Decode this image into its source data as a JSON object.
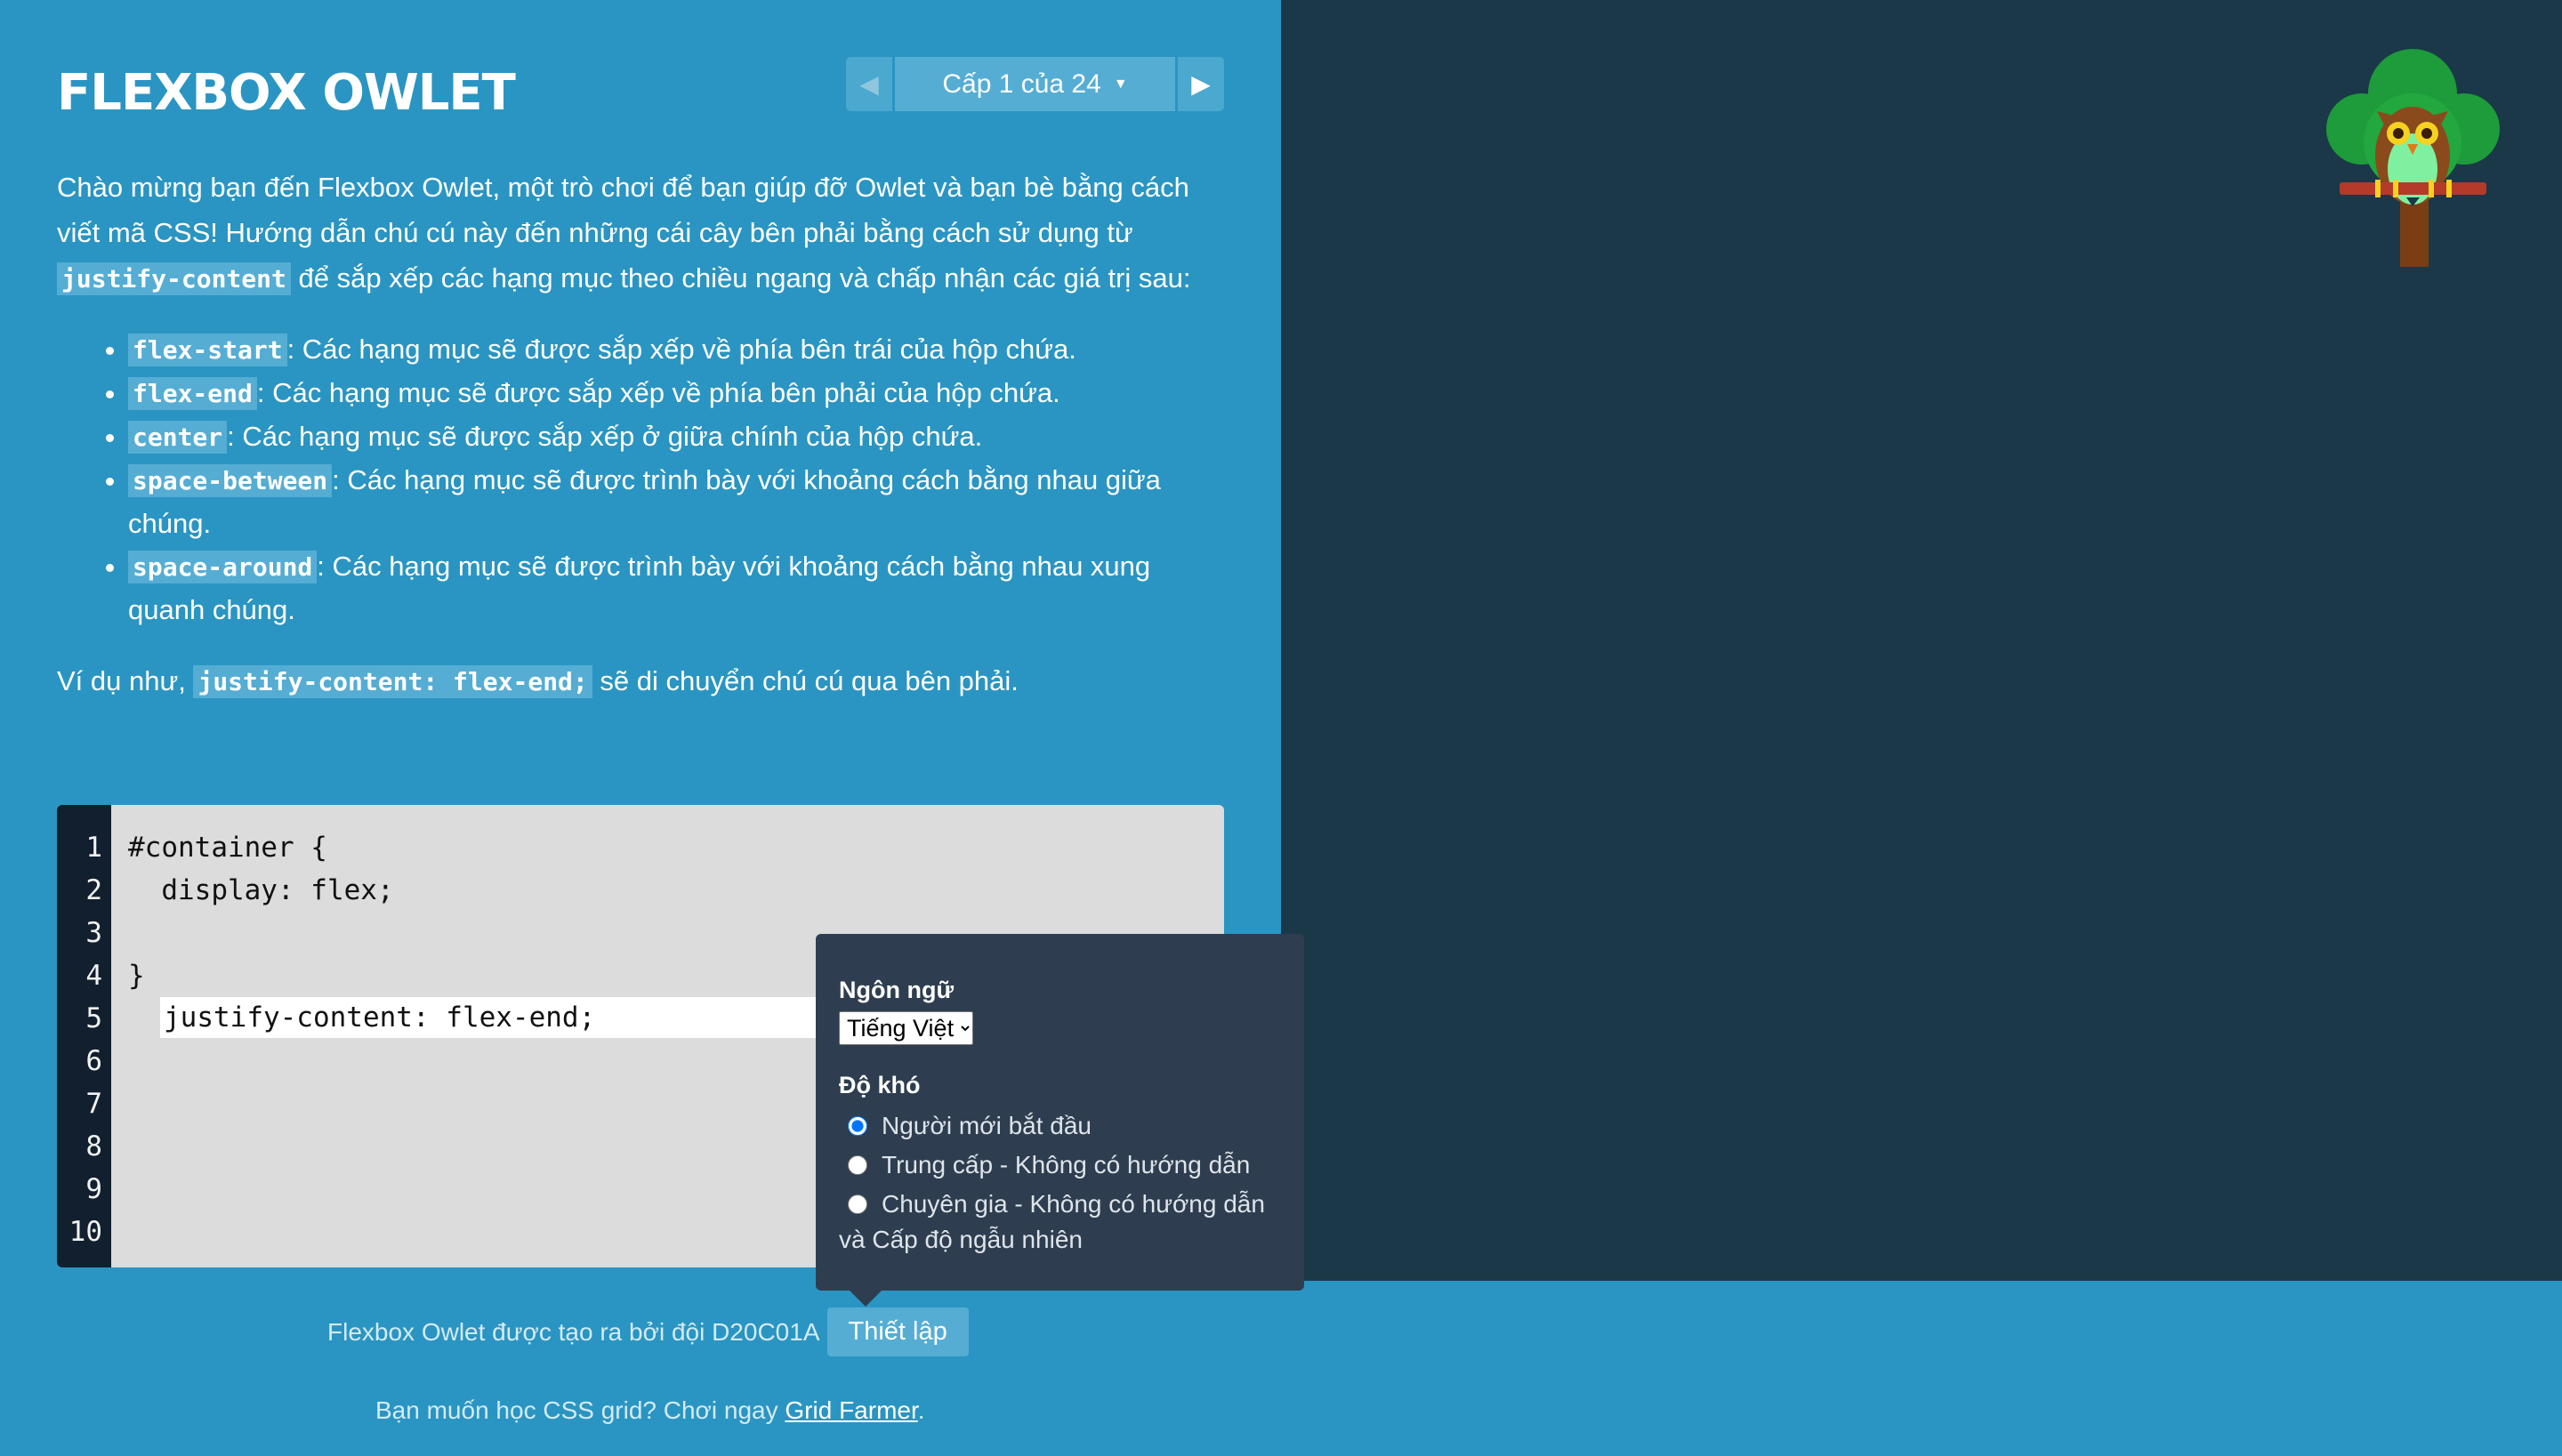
{
  "header": {
    "title": "FLEXBOX OWLET",
    "level_label": "Cấp 1 của 24",
    "prev_icon": "triangle-left",
    "next_icon": "triangle-right"
  },
  "instructions": {
    "intro": "Chào mừng bạn đến Flexbox Owlet, một trò chơi để bạn giúp đỡ Owlet và bạn bè bằng cách viết mã CSS! Hướng dẫn chú cú này đến những cái cây bên phải bằng cách sử dụng từ",
    "property_code": "justify-content",
    "intro_tail": "để sắp xếp các hạng mục theo chiều ngang và chấp nhận các giá trị sau:",
    "values": [
      {
        "code": "flex-start",
        "desc": ": Các hạng mục sẽ được sắp xếp về phía bên trái của hộp chứa."
      },
      {
        "code": "flex-end",
        "desc": ": Các hạng mục sẽ được sắp xếp về phía bên phải của hộp chứa."
      },
      {
        "code": "center",
        "desc": ": Các hạng mục sẽ được sắp xếp ở giữa chính của hộp chứa."
      },
      {
        "code": "space-between",
        "desc": ": Các hạng mục sẽ được trình bày với khoảng cách bằng nhau giữa chúng."
      },
      {
        "code": "space-around",
        "desc": ": Các hạng mục sẽ được trình bày với khoảng cách bằng nhau xung quanh chúng."
      }
    ],
    "example_prefix": "Ví dụ như,",
    "example_code": "justify-content: flex-end;",
    "example_suffix": "sẽ di chuyển chú cú qua bên phải."
  },
  "editor": {
    "line_numbers": [
      "1",
      "2",
      "3",
      "4",
      "5",
      "6",
      "7",
      "8",
      "9",
      "10"
    ],
    "line1": "#container {",
    "line2": "  display: flex;",
    "input_value": "justify-content: flex-end;",
    "line4": "}"
  },
  "settings": {
    "language_heading": "Ngôn ngữ",
    "language_selected": "Tiếng Việt",
    "difficulty_heading": "Độ khó",
    "options": [
      {
        "label": "Người mới bắt đầu",
        "checked": true
      },
      {
        "label": "Trung cấp - Không có hướng dẫn",
        "checked": false
      },
      {
        "label": "Chuyên gia - Không có hướng dẫn",
        "checked": false
      }
    ],
    "option_suffix": "và Cấp độ ngẫu nhiên"
  },
  "footer": {
    "credits": "Flexbox Owlet được tạo ra bởi đội D20C01A",
    "settings_button": "Thiết lập",
    "promo_prefix": "Bạn muốn học CSS grid? Chơi ngay",
    "promo_link": "Grid Farmer",
    "promo_suffix": "."
  },
  "board": {
    "tree_icon": "owl-on-tree-icon",
    "board_color": "#1a3848",
    "sidebar_color": "#2a95c2"
  }
}
